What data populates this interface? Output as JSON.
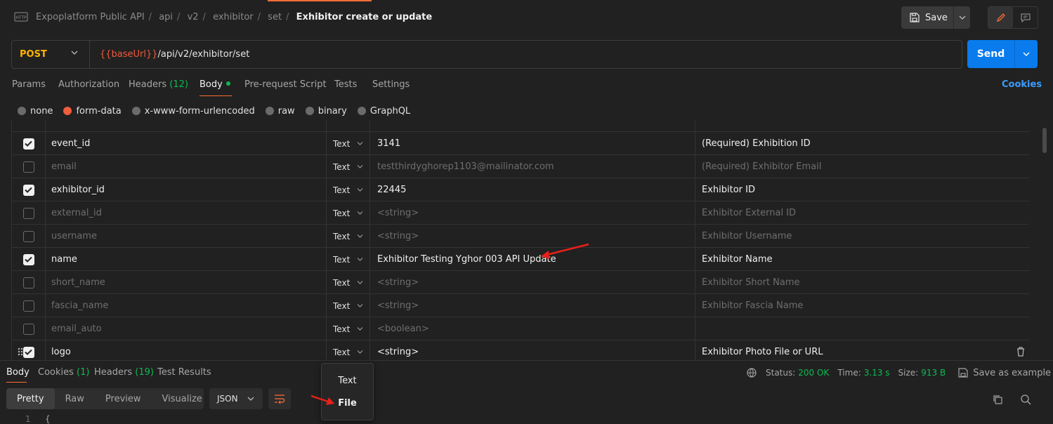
{
  "breadcrumb": [
    "Expoplatform Public API",
    "api",
    "v2",
    "exhibitor",
    "set"
  ],
  "request_name": "Exhibitor create or update",
  "save_label": "Save",
  "method": "POST",
  "url": {
    "variable": "{{baseUrl}}",
    "path": "/api/v2/exhibitor/set"
  },
  "send_label": "Send",
  "tabs": {
    "params": "Params",
    "authorization": "Authorization",
    "headers": "Headers",
    "headers_count": "(12)",
    "body": "Body",
    "prerequest": "Pre-request Script",
    "tests": "Tests",
    "settings": "Settings",
    "cookies": "Cookies"
  },
  "body_types": [
    "none",
    "form-data",
    "x-www-form-urlencoded",
    "raw",
    "binary",
    "GraphQL"
  ],
  "selected_body_type": "form-data",
  "form_rows": [
    {
      "checked": true,
      "key": "event_id",
      "type": "Text",
      "value": "3141",
      "description": "(Required) Exhibition ID"
    },
    {
      "checked": false,
      "key": "email",
      "type": "Text",
      "value": "testthirdyghorep1103@mailinator.com",
      "description": "(Required) Exhibitor Email"
    },
    {
      "checked": true,
      "key": "exhibitor_id",
      "type": "Text",
      "value": "22445",
      "description": "Exhibitor ID"
    },
    {
      "checked": false,
      "key": "external_id",
      "type": "Text",
      "value": "<string>",
      "description": "Exhibitor External ID"
    },
    {
      "checked": false,
      "key": "username",
      "type": "Text",
      "value": "<string>",
      "description": "Exhibitor Username"
    },
    {
      "checked": true,
      "key": "name",
      "type": "Text",
      "value": "Exhibitor Testing Yghor 003 API Update",
      "description": "Exhibitor Name"
    },
    {
      "checked": false,
      "key": "short_name",
      "type": "Text",
      "value": "<string>",
      "description": "Exhibitor Short Name"
    },
    {
      "checked": false,
      "key": "fascia_name",
      "type": "Text",
      "value": "<string>",
      "description": "Exhibitor Fascia Name"
    },
    {
      "checked": false,
      "key": "email_auto",
      "type": "Text",
      "value": "<boolean>",
      "description": ""
    },
    {
      "checked": true,
      "key": "logo",
      "type": "Text",
      "value": "<string>",
      "description": "Exhibitor Photo File or URL"
    }
  ],
  "response_tabs": {
    "body": "Body",
    "cookies": "Cookies",
    "cookies_count": "(1)",
    "headers": "Headers",
    "headers_count": "(19)",
    "test_results": "Test Results"
  },
  "status": {
    "status_label": "Status:",
    "status_value": "200 OK",
    "time_label": "Time:",
    "time_value": "3.13 s",
    "size_label": "Size:",
    "size_value": "913 B",
    "save_example": "Save as example"
  },
  "view_modes": [
    "Pretty",
    "Raw",
    "Preview",
    "Visualize"
  ],
  "selected_view_mode": "Pretty",
  "format": "JSON",
  "line_number": "1",
  "code_first_line": "{",
  "type_dropdown": [
    "Text",
    "File"
  ],
  "colors": {
    "accent": "#ff6c37",
    "send": "#097bed",
    "method": "#ffb400",
    "success": "#0cbb52",
    "variable": "#f05a3c",
    "annotation_arrow": "#e8201a"
  },
  "icons": [
    "http-icon",
    "save-icon",
    "edit-icon",
    "comment-icon",
    "chevron-down-icon",
    "drag-handle-icon",
    "trash-icon",
    "globe-icon",
    "wrap-icon",
    "copy-icon",
    "search-icon",
    "more-icon"
  ]
}
